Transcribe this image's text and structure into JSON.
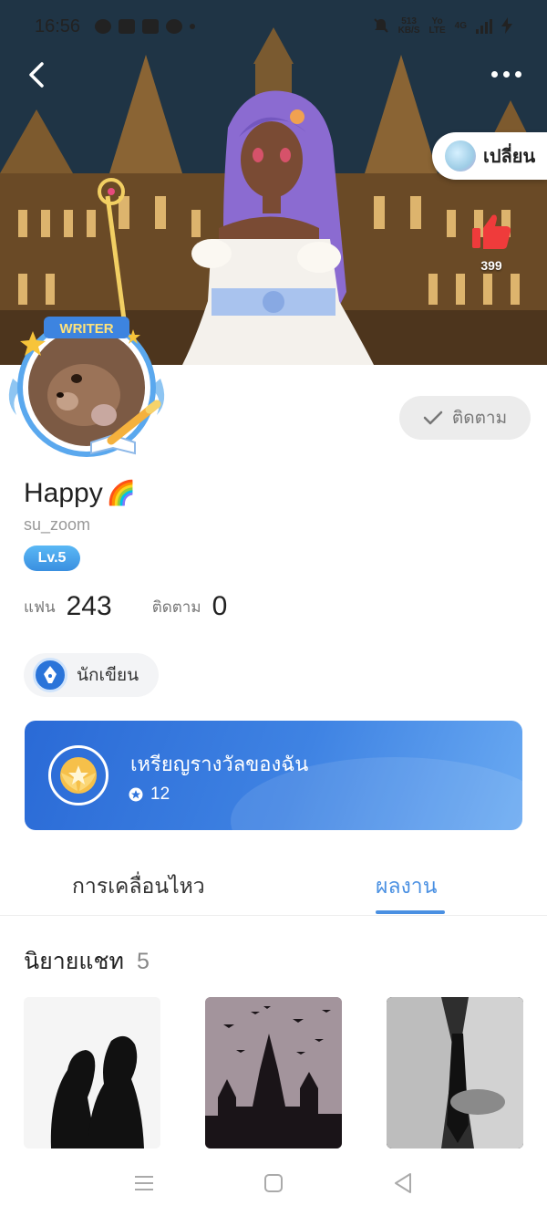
{
  "status_bar": {
    "time": "16:56",
    "net_speed": "513",
    "net_unit": "KB/S",
    "net_type_top": "Yo",
    "net_type_bottom": "LTE",
    "signal_label": "4G"
  },
  "header": {
    "back_icon": "chevron-left-icon",
    "more_icon": "more-dots-icon",
    "change_label": "เปลี่ยน",
    "like_count": "399"
  },
  "profile": {
    "avatar_frame_label": "WRITER",
    "display_name": "Happy",
    "display_emoji": "🌈",
    "username": "su_zoom",
    "level": "Lv.5",
    "follow_label": "ติดตาม",
    "stats": [
      {
        "label": "แฟน",
        "value": "243"
      },
      {
        "label": "ติดตาม",
        "value": "0"
      }
    ],
    "role_chip": "นักเขียน"
  },
  "medal_card": {
    "title": "เหรียญรางวัลของฉัน",
    "count": "12"
  },
  "tabs": [
    {
      "label": "การเคลื่อนไหว",
      "active": false
    },
    {
      "label": "ผลงาน",
      "active": true
    }
  ],
  "works_section": {
    "title": "นิยายแชท",
    "count": "5"
  },
  "theme": {
    "accent": "#4a90e2",
    "like_red": "#ef3b3b"
  }
}
